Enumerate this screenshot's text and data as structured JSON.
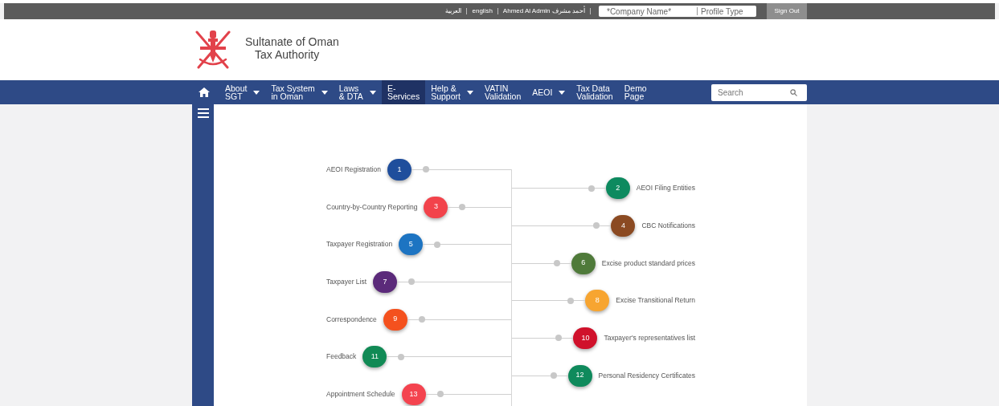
{
  "top_bar": {
    "language_links": [
      {
        "label": "العربية"
      },
      {
        "label": "english"
      }
    ],
    "user": "أحمد مشرف Ahmed Al Admin",
    "company_field": {
      "placeholder": "*Company Name*"
    },
    "profile_type": {
      "placeholder": "Profile Type"
    },
    "sign_out": "Sign Out"
  },
  "header": {
    "title": "Sultanate of Oman",
    "subtitle": "Tax Authority"
  },
  "nav": {
    "items": [
      {
        "lines": [
          "About",
          "SGT"
        ],
        "dropdown": true,
        "selected": false
      },
      {
        "lines": [
          "Tax System",
          "in Oman"
        ],
        "dropdown": true,
        "selected": false
      },
      {
        "lines": [
          "Laws",
          "& DTA"
        ],
        "dropdown": true,
        "selected": false
      },
      {
        "lines": [
          "E-",
          "Services"
        ],
        "dropdown": false,
        "selected": true
      },
      {
        "lines": [
          "Help &",
          "Support"
        ],
        "dropdown": true,
        "selected": false
      },
      {
        "lines": [
          "VATIN",
          "Validation"
        ],
        "dropdown": false,
        "selected": false
      },
      {
        "lines": [
          "AEOI"
        ],
        "dropdown": true,
        "selected": false
      },
      {
        "lines": [
          "Tax Data",
          "Validation"
        ],
        "dropdown": false,
        "selected": false
      },
      {
        "lines": [
          "Demo",
          "Page"
        ],
        "dropdown": false,
        "selected": false
      }
    ],
    "search": {
      "placeholder": "Search"
    }
  },
  "services": [
    {
      "number": "1",
      "label": "AEOI Registration",
      "color": "#1f4e9c"
    },
    {
      "number": "2",
      "label": "AEOI Filing Entities",
      "color": "#0d8a5f"
    },
    {
      "number": "3",
      "label": "Country-by-Country Reporting",
      "color": "#f2434b"
    },
    {
      "number": "4",
      "label": "CBC Notifications",
      "color": "#8b4a22"
    },
    {
      "number": "5",
      "label": "Taxpayer Registration",
      "color": "#1d74c2"
    },
    {
      "number": "6",
      "label": "Excise product standard prices",
      "color": "#4f7a3a"
    },
    {
      "number": "7",
      "label": "Taxpayer List",
      "color": "#5b2a7a"
    },
    {
      "number": "8",
      "label": "Excise Transitional Return",
      "color": "#f7a531"
    },
    {
      "number": "9",
      "label": "Correspondence",
      "color": "#f4511e"
    },
    {
      "number": "10",
      "label": "Taxpayer's representatives list",
      "color": "#d0112b"
    },
    {
      "number": "11",
      "label": "Feedback",
      "color": "#118a55"
    },
    {
      "number": "12",
      "label": "Personal Residency Certificates",
      "color": "#0f8a5c"
    },
    {
      "number": "13",
      "label": "Appointment Schedule",
      "color": "#f4434f"
    }
  ]
}
